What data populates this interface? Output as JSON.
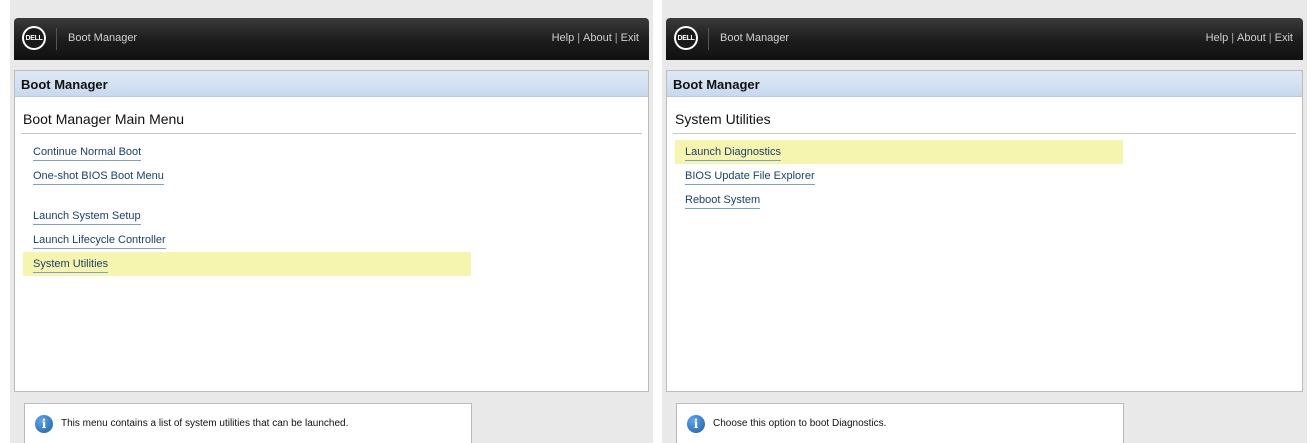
{
  "screens": [
    {
      "topbar": {
        "logo": "DELL",
        "title": "Boot Manager",
        "links": [
          "Help",
          "About",
          "Exit"
        ],
        "separator": "|"
      },
      "panel_header": "Boot Manager",
      "section_title": "Boot Manager Main Menu",
      "menu": [
        {
          "label": "Continue Normal Boot",
          "selected": false
        },
        {
          "label": "One-shot BIOS Boot Menu",
          "selected": false
        },
        {
          "label": "Launch System Setup",
          "selected": false
        },
        {
          "label": "Launch Lifecycle Controller",
          "selected": false
        },
        {
          "label": "System Utilities",
          "selected": true
        }
      ],
      "info": {
        "icon": "info-icon",
        "text": "This menu contains a list of system utilities that can be launched."
      }
    },
    {
      "topbar": {
        "logo": "DELL",
        "title": "Boot Manager",
        "links": [
          "Help",
          "About",
          "Exit"
        ],
        "separator": "|"
      },
      "panel_header": "Boot Manager",
      "section_title": "System Utilities",
      "menu": [
        {
          "label": "Launch Diagnostics",
          "selected": true
        },
        {
          "label": "BIOS Update File Explorer",
          "selected": false
        },
        {
          "label": "Reboot System",
          "selected": false
        }
      ],
      "info": {
        "icon": "info-icon",
        "text": "Choose this option to boot Diagnostics."
      }
    }
  ],
  "colors": {
    "highlight": "#f5f5b0",
    "link": "#1d3f6e",
    "header_bar": "#1c1c1c",
    "panel_header": "#c8d9ee"
  }
}
